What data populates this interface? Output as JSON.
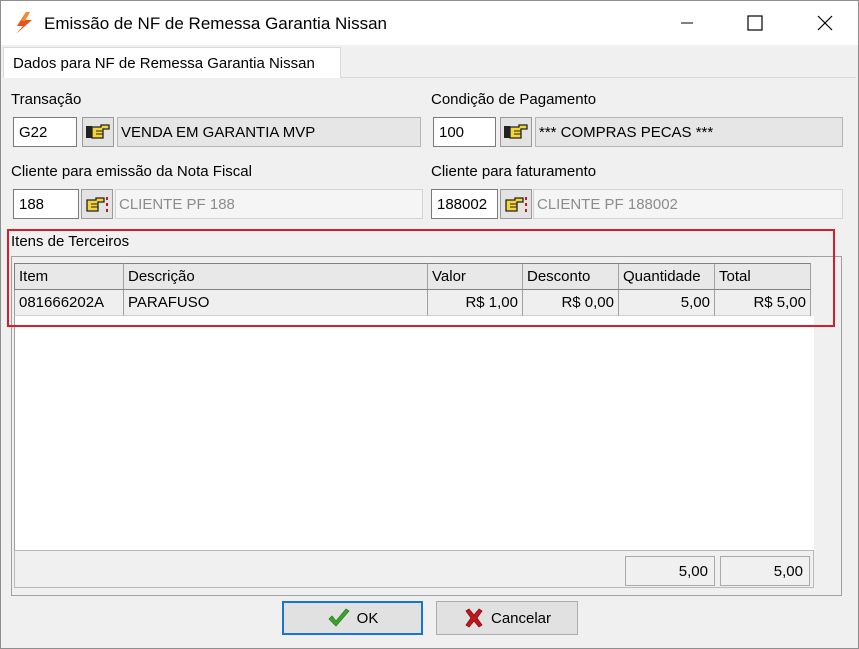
{
  "window": {
    "title": "Emissão de NF de Remessa Garantia Nissan",
    "app_icon": "lightning-icon",
    "controls": [
      "minimize-icon",
      "maximize-icon",
      "close-icon"
    ]
  },
  "tab": {
    "label": "Dados para NF de Remessa Garantia Nissan"
  },
  "transacao": {
    "label": "Transação",
    "value": "G22",
    "description": "VENDA EM GARANTIA MVP"
  },
  "condicao": {
    "label": "Condição de Pagamento",
    "value": "100",
    "description": "*** COMPRAS PECAS ***"
  },
  "cliente_emissao": {
    "label": "Cliente para emissão da Nota Fiscal",
    "value": "188",
    "description": "CLIENTE PF 188"
  },
  "cliente_faturamento": {
    "label": "Cliente para faturamento",
    "value": "188002",
    "description": "CLIENTE PF 188002"
  },
  "itens": {
    "label": "Itens de Terceiros",
    "columns": [
      "Item",
      "Descrição",
      "Valor",
      "Desconto",
      "Quantidade",
      "Total"
    ],
    "rows": [
      [
        "081666202A",
        "PARAFUSO",
        "R$ 1,00",
        "R$ 0,00",
        "5,00",
        "R$ 5,00"
      ]
    ],
    "totals": {
      "quantidade": "5,00",
      "total": "5,00"
    }
  },
  "buttons": {
    "ok": "OK",
    "cancel": "Cancelar"
  },
  "colors": {
    "highlight": "#d21f2b",
    "ok_border": "#1876d2",
    "check": "#3aa629",
    "cross": "#c0161e"
  }
}
